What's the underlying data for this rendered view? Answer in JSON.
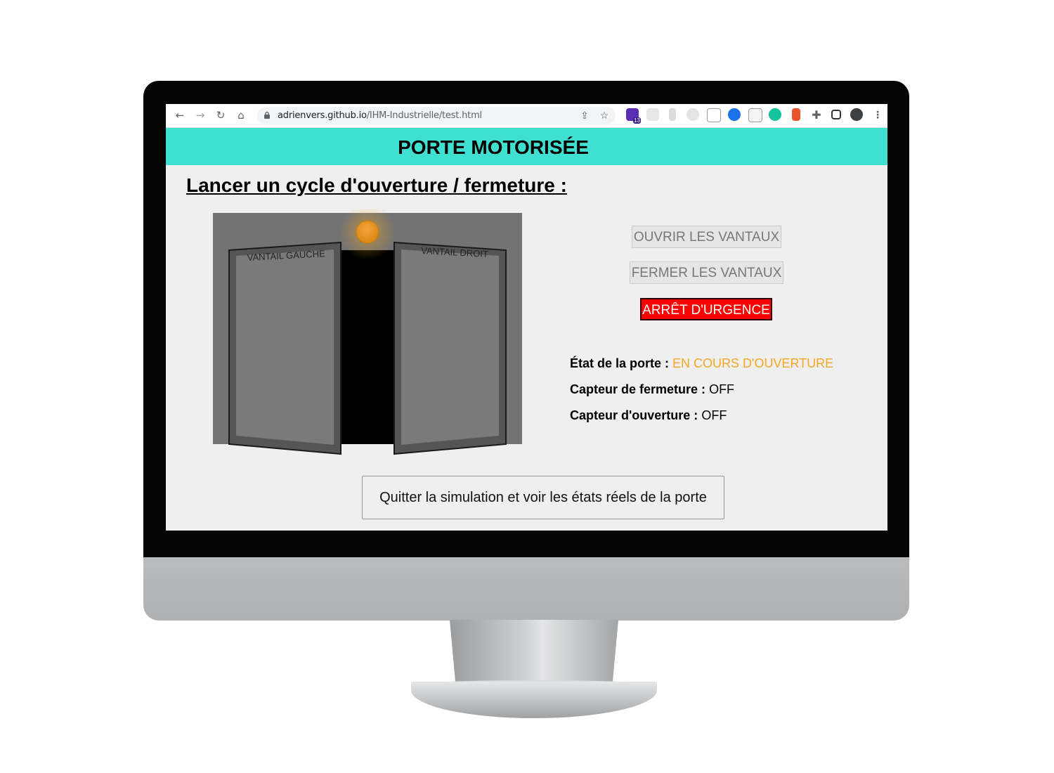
{
  "browser": {
    "url_domain": "adrienvers.github.io",
    "url_path": "/IHM-Industrielle/test.html",
    "extension_badge": "13",
    "nav_icons": [
      "back-arrow-icon",
      "forward-arrow-icon",
      "reload-icon",
      "home-icon"
    ],
    "omnibox_icons": [
      "lock-icon",
      "share-icon",
      "star-icon"
    ],
    "menu_icon": "kebab-menu-icon"
  },
  "header": {
    "title": "PORTE MOTORISÉE",
    "background_color": "#40e0d0"
  },
  "section": {
    "title": "Lancer un cycle d'ouverture / fermeture :"
  },
  "door": {
    "left_leaf_label": "VANTAIL GAUCHE",
    "right_leaf_label": "VANTAIL DROIT",
    "warning_light_color": "#f5a623"
  },
  "controls": {
    "open_label": "OUVRIR LES VANTAUX",
    "close_label": "FERMER LES VANTAUX",
    "emergency_label": "ARRÊT D'URGENCE",
    "emergency_color": "#ff0000"
  },
  "status": {
    "door_state_label": "État de la porte :",
    "door_state_value": "EN COURS D'OUVERTURE",
    "door_state_color": "#f5a623",
    "close_sensor_label": "Capteur de fermeture :",
    "close_sensor_value": "OFF",
    "open_sensor_label": "Capteur d'ouverture :",
    "open_sensor_value": "OFF"
  },
  "footer": {
    "quit_label": "Quitter la simulation et voir les états réels de la porte"
  }
}
